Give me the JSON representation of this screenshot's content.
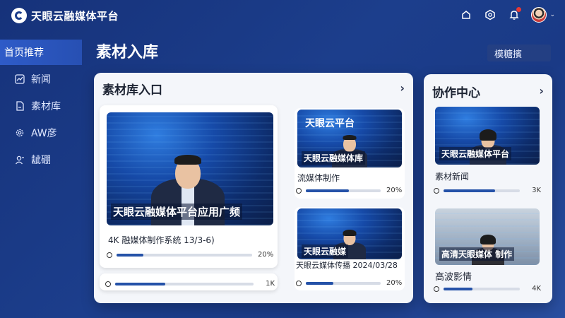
{
  "app": {
    "title": "天眼云融媒体平台"
  },
  "sidebar": {
    "items": [
      {
        "label": "首页推荐",
        "icon": "home-icon",
        "active": true
      },
      {
        "label": "新闻",
        "icon": "chart-icon",
        "active": false
      },
      {
        "label": "素材库",
        "icon": "document-icon",
        "active": false
      },
      {
        "label": "AW彦",
        "icon": "gear-icon",
        "active": false
      },
      {
        "label": "龇硼",
        "icon": "user-icon",
        "active": false
      }
    ]
  },
  "page": {
    "title": "素材入库",
    "filter_label": "模糖擯"
  },
  "library": {
    "title": "素材库入口",
    "featured": {
      "caption": "天眼云融媒体平台应用广频",
      "title": "4K 融媒体制作系统 13/3-6)",
      "progress": 20,
      "progress_label": "20%"
    },
    "featured_bottom": {
      "progress": 36,
      "progress_label": "1K"
    },
    "items": [
      {
        "caption": "天眼云融媒体库",
        "overlay": "天眼云平台",
        "title": "流媒体制作",
        "progress": 58,
        "progress_label": "20%"
      },
      {
        "caption": "天眼云融媒",
        "title": "天眼云媒体传播 2024/03/28",
        "progress": 37,
        "progress_label": "20%"
      }
    ]
  },
  "collab": {
    "title": "协作中心",
    "items": [
      {
        "caption": "天眼云融媒体平台",
        "title": "素材新闻",
        "progress": 68,
        "progress_label": "3K"
      },
      {
        "caption": "高清天眼媒体 制作",
        "title": "高波影情",
        "progress": 38,
        "progress_label": "4K"
      }
    ]
  },
  "colors": {
    "accent": "#2552a8",
    "background": "#1c3e8c"
  }
}
